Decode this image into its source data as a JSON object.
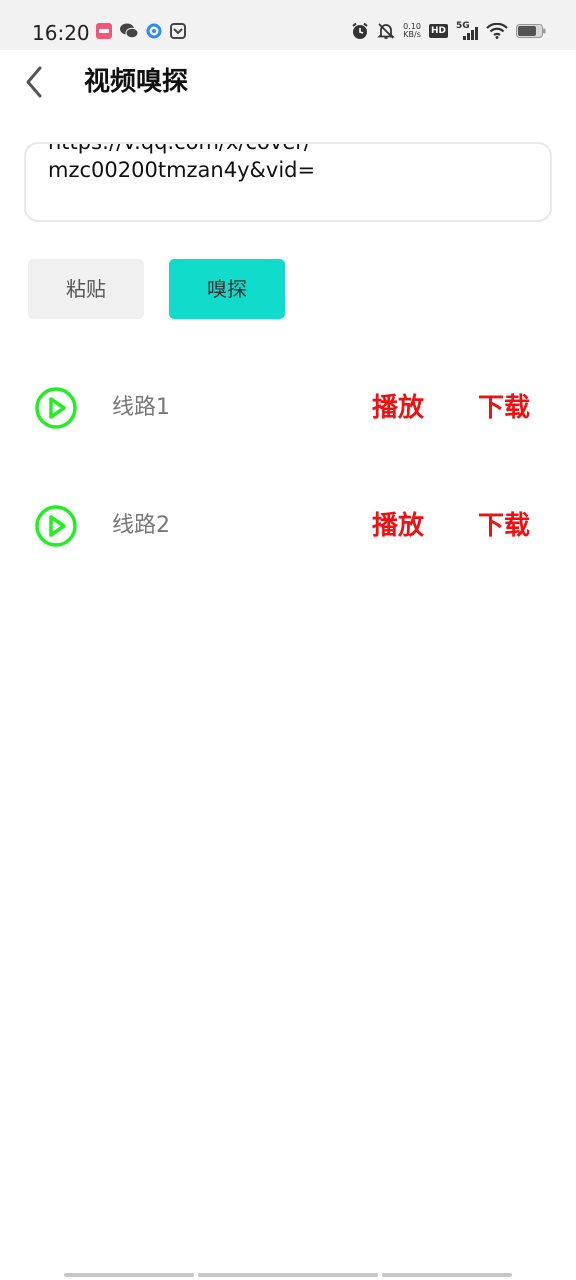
{
  "status_bar": {
    "time": "16:20",
    "net_speed_value": "0.10",
    "net_speed_unit": "KB/s",
    "hd_label": "HD",
    "network_label": "5G",
    "left_icons": [
      "app-notification-icon",
      "wechat-icon",
      "browser-icon",
      "inbox-icon"
    ],
    "right_icons": [
      "alarm-icon",
      "mute-icon",
      "hd-icon",
      "signal-5g-icon",
      "wifi-icon",
      "battery-icon"
    ]
  },
  "header": {
    "back_icon": "chevron-left-icon",
    "title": "视频嗅探"
  },
  "url_input": {
    "line1": "https://v.qq.com/x/cover/",
    "line2": "mzc00200tmzan4y&vid="
  },
  "actions": {
    "paste_label": "粘贴",
    "sniff_label": "嗅探"
  },
  "routes": [
    {
      "name": "线路1",
      "play_label": "播放",
      "download_label": "下载"
    },
    {
      "name": "线路2",
      "play_label": "播放",
      "download_label": "下载"
    }
  ],
  "colors": {
    "accent": "#11dccb",
    "action_red": "#ee1111",
    "play_icon_green": "#22ee22",
    "status_bar_bg": "#f2f2f2"
  }
}
